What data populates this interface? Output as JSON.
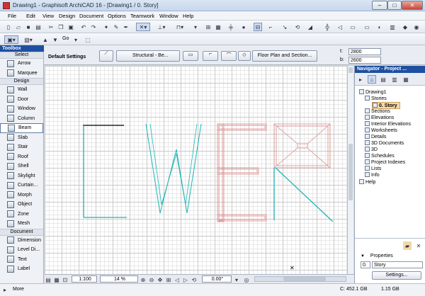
{
  "window": {
    "title": "Drawing1 - Graphisoft ArchiCAD 16 - [Drawing1 / 0. Story]",
    "min": "–",
    "max": "□",
    "close": "✕"
  },
  "menu": [
    "File",
    "Edit",
    "View",
    "Design",
    "Document",
    "Options",
    "Teamwork",
    "Window",
    "Help"
  ],
  "toolbar": {
    "go_label": "Go"
  },
  "infobox": {
    "default_settings": "Default Settings",
    "structural": "Structural - Be...",
    "floor_plan_btn": "Floor Plan and Section...",
    "t_label": "t:",
    "t_value": "2800",
    "b_label": "b:",
    "b_value": "2600"
  },
  "toolbox": {
    "title": "Toolbox",
    "select_label": "Select",
    "sections": {
      "design": "Design",
      "document": "Document"
    },
    "select_items": [
      "Arrow",
      "Marquee"
    ],
    "design_items": [
      "Wall",
      "Door",
      "Window",
      "Column",
      "Beam",
      "Slab",
      "Stair",
      "Roof",
      "Shell",
      "Skylight",
      "Curtain...",
      "Morph",
      "Object",
      "Zone",
      "Mesh"
    ],
    "document_items": [
      "Dimension",
      "Level Di...",
      "Text",
      "Label"
    ],
    "more": "More"
  },
  "navigator": {
    "title": "Navigator - Project ...",
    "tree": {
      "root": "Drawing1",
      "stories": "Stories",
      "story0": "0. Story",
      "items": [
        "Sections",
        "Elevations",
        "Interior Elevations",
        "Worksheets",
        "Details",
        "3D Documents",
        "3D",
        "Schedules",
        "Project Indexes",
        "Lists",
        "Info",
        "Help"
      ]
    },
    "properties_label": "Properties",
    "prop_id": "0.",
    "prop_value": "Story",
    "settings_btn": "Settings..."
  },
  "statusbar": {
    "scale": "1:100",
    "zoom": "14 %",
    "angle": "0.00°"
  },
  "bottombar": {
    "disk": "C: 452.1 GB",
    "memory": "1.15 GB"
  },
  "colors": {
    "cyan": "#1fb5b5",
    "pink": "#d98a8a",
    "title_blue": "#1e4fa0"
  }
}
